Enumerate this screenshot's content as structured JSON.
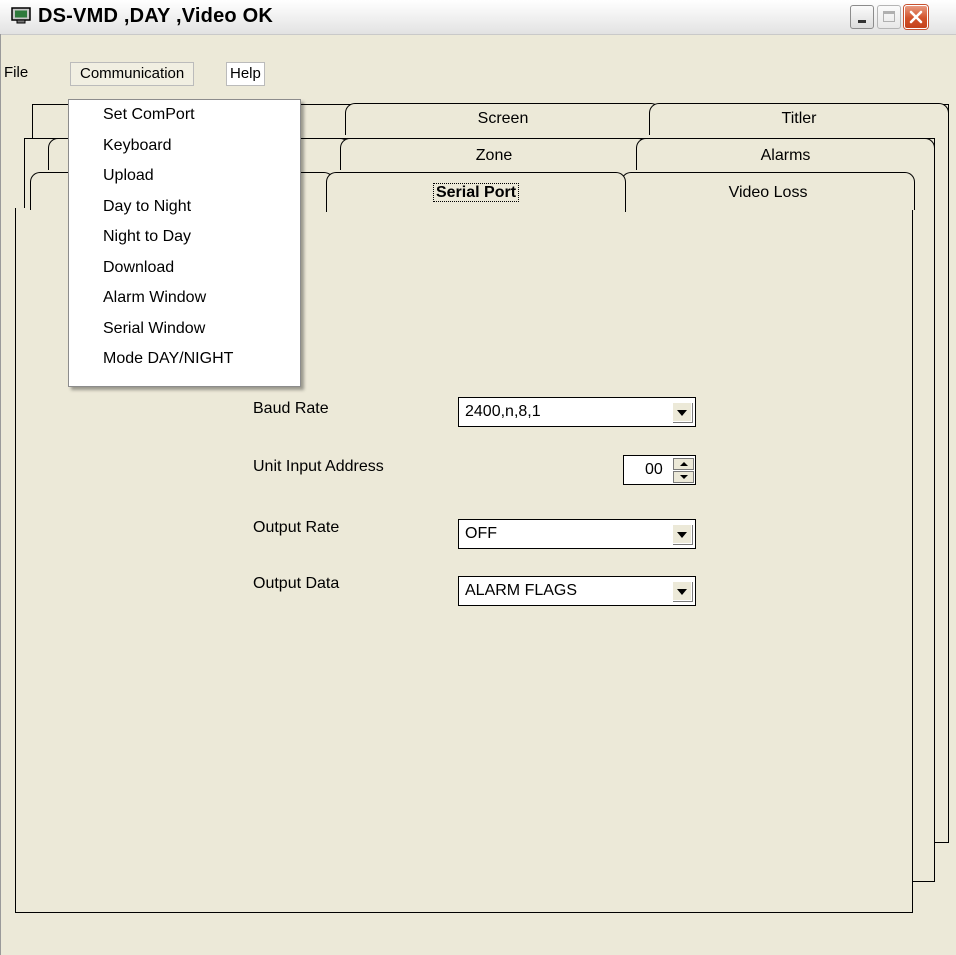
{
  "window": {
    "title": "DS-VMD ,DAY ,Video OK",
    "app_icon": "monitor-icon",
    "buttons": [
      "minimize-icon",
      "maximize-icon",
      "close-icon"
    ]
  },
  "menubar": {
    "file": "File",
    "communication": "Communication",
    "help": "Help"
  },
  "communication_menu": {
    "items": [
      "Set ComPort",
      "Keyboard",
      "Upload",
      "Day to Night",
      "Night to Day",
      "Download",
      "Alarm Window",
      "Serial Window",
      "Mode DAY/NIGHT"
    ]
  },
  "tabs": {
    "row1": [
      "Screen",
      "Titler"
    ],
    "row2": [
      "Zone",
      "Alarms"
    ],
    "row3": [
      "Serial Port",
      "Video Loss"
    ],
    "active": "Serial Port"
  },
  "serial_port": {
    "baud_rate_label": "Baud Rate",
    "baud_rate_value": "2400,n,8,1",
    "unit_input_address_label": "Unit Input Address",
    "unit_input_address_value": "00",
    "output_rate_label": "Output Rate",
    "output_rate_value": "OFF",
    "output_data_label": "Output Data",
    "output_data_value": "ALARM FLAGS"
  }
}
